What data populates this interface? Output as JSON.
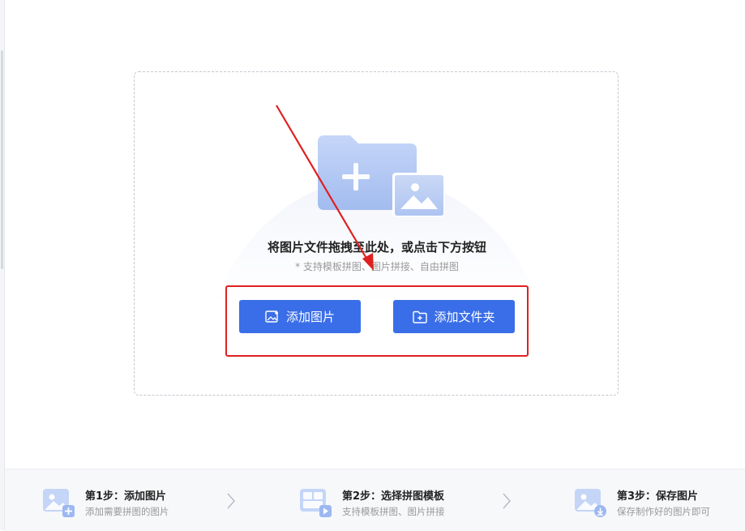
{
  "drop_zone": {
    "title": "将图片文件拖拽至此处，或点击下方按钮",
    "subtitle": "* 支持模板拼图、图片拼接、自由拼图",
    "add_image_label": "添加图片",
    "add_folder_label": "添加文件夹"
  },
  "steps": [
    {
      "title": "第1步：添加图片",
      "desc": "添加需要拼图的图片",
      "icon": "image-add-icon"
    },
    {
      "title": "第2步：选择拼图模板",
      "desc": "支持模板拼图、图片拼接",
      "icon": "template-select-icon"
    },
    {
      "title": "第3步：保存图片",
      "desc": "保存制作好的图片即可",
      "icon": "image-save-icon"
    }
  ],
  "colors": {
    "accent": "#3a6ee8",
    "annotation_red": "#e02020",
    "illustration_blue": "#a9c3f5"
  }
}
